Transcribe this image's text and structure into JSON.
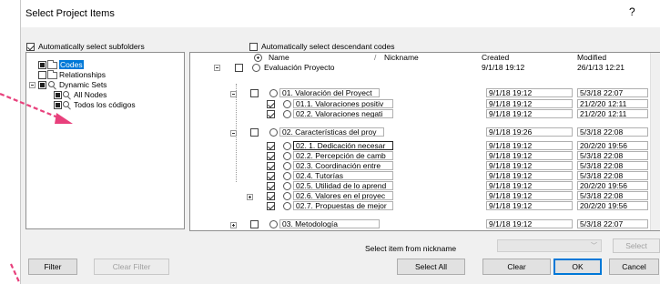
{
  "dialog": {
    "title": "Select Project Items",
    "help": "?"
  },
  "options": {
    "auto_select_subfolders": "Automatically select subfolders",
    "auto_select_descendant_codes": "Automatically select descendant codes"
  },
  "left_tree": [
    {
      "label": "Codes",
      "selected": true
    },
    {
      "label": "Relationships"
    },
    {
      "label": "Dynamic Sets"
    },
    {
      "label": "All Nodes"
    },
    {
      "label": "Todos los códigos"
    }
  ],
  "grid": {
    "columns": [
      "Name",
      "Nickname",
      "Created",
      "Modified"
    ],
    "sort_icon": "plus-circle-icon",
    "rows": [
      {
        "name": "Evaluación Proyecto",
        "created": "9/1/18 19:12",
        "modified": "26/1/13 12:21"
      },
      {
        "name": "01. Valoración del Proyect",
        "created": "9/1/18 19:12",
        "modified": "5/3/18 22:07"
      },
      {
        "name": "01.1. Valoraciones positiv",
        "created": "9/1/18 19:12",
        "modified": "21/2/20 12:11"
      },
      {
        "name": "02.2. Valoraciones negati",
        "created": "9/1/18 19:12",
        "modified": "21/2/20 12:11"
      },
      {
        "name": "02. Características del proy",
        "created": "9/1/18 19:26",
        "modified": "5/3/18 22:08"
      },
      {
        "name": "02. 1. Dedicación necesar",
        "created": "9/1/18 19:12",
        "modified": "20/2/20 19:56"
      },
      {
        "name": "02.2. Percepción de camb",
        "created": "9/1/18 19:12",
        "modified": "5/3/18 22:08"
      },
      {
        "name": "02.3. Coordinación entre",
        "created": "9/1/18 19:12",
        "modified": "5/3/18 22:08"
      },
      {
        "name": "02.4. Tutorías",
        "created": "9/1/18 19:12",
        "modified": "5/3/18 22:08"
      },
      {
        "name": "02.5. Utilidad de lo aprend",
        "created": "9/1/18 19:12",
        "modified": "20/2/20 19:56"
      },
      {
        "name": "02.6. Valores en el proyec",
        "created": "9/1/18 19:12",
        "modified": "5/3/18 22:08"
      },
      {
        "name": "02.7. Propuestas de mejor",
        "created": "9/1/18 19:12",
        "modified": "20/2/20 19:56"
      },
      {
        "name": "03. Metodología",
        "created": "9/1/18 19:12",
        "modified": "5/3/18 22:07"
      }
    ]
  },
  "nickname": {
    "label": "Select item from nickname",
    "button": "Select"
  },
  "buttons": {
    "filter": "Filter",
    "clear_filter": "Clear Filter",
    "select_all": "Select All",
    "clear": "Clear",
    "ok": "OK",
    "cancel": "Cancel"
  },
  "colors": {
    "accent": "#0078d7",
    "annotation_arrow": "#e8407c",
    "dialog_bg": "#f0f0f0"
  }
}
